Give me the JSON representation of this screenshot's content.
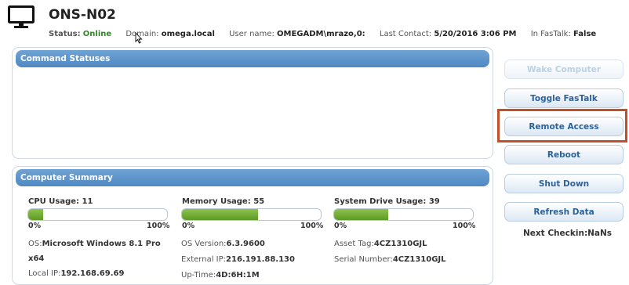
{
  "header": {
    "computer_name": "ONS-N02",
    "status_label": "Status:",
    "status_value": "Online",
    "domain_label": "Domain:",
    "domain_value": "omega.local",
    "user_label": "User name:",
    "user_value": "OMEGADM\\mrazo,0:",
    "contact_label": "Last Contact:",
    "contact_value": "5/20/2016 3:06 PM",
    "fastalk_label": "In FasTalk:",
    "fastalk_value": "False"
  },
  "command_panel": {
    "title": "Command Statuses"
  },
  "summary_panel": {
    "title": "Computer Summary",
    "cpu": {
      "label": "CPU Usage: 11",
      "percent": 11,
      "min": "0%",
      "max": "100%"
    },
    "memory": {
      "label": "Memory Usage: 55",
      "percent": 55,
      "min": "0%",
      "max": "100%"
    },
    "drive": {
      "label": "System Drive Usage: 39",
      "percent": 39,
      "min": "0%",
      "max": "100%"
    },
    "os_label": "OS:",
    "os_value": "Microsoft Windows 8.1 Pro",
    "os_value2": "x64",
    "local_ip_label": "Local IP:",
    "local_ip_value": "192.168.69.69",
    "os_version_label": "OS Version:",
    "os_version_value": "6.3.9600",
    "external_ip_label": "External IP:",
    "external_ip_value": "216.191.88.130",
    "uptime_label": "Up-Time:",
    "uptime_value": "4D:6H:1M",
    "asset_tag_label": "Asset Tag:",
    "asset_tag_value": "4CZ1310GJL",
    "serial_label": "Serial Number:",
    "serial_value": "4CZ1310GJL"
  },
  "actions": {
    "wake": "Wake Computer",
    "toggle_fastalk": "Toggle FasTalk",
    "remote_access": "Remote Access",
    "reboot": "Reboot",
    "shutdown": "Shut Down",
    "refresh": "Refresh Data",
    "next_checkin": "Next Checkin:NaNs"
  },
  "colors": {
    "accent": "#4f88c3",
    "online": "#2e8b22",
    "highlight": "#c0502a",
    "bar_fill": "#6aa531"
  },
  "icons": {
    "computer": "monitor-icon",
    "cursor": "mouse-pointer-icon"
  }
}
